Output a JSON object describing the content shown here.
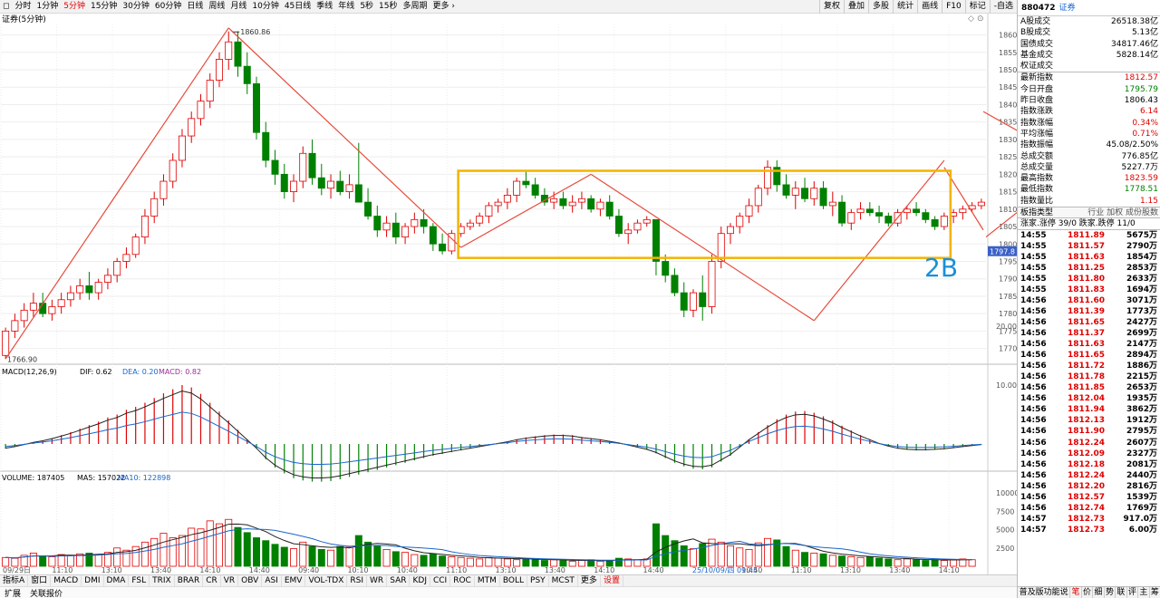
{
  "periods": [
    "分时",
    "1分钟",
    "5分钟",
    "15分钟",
    "30分钟",
    "60分钟",
    "日线",
    "周线",
    "月线",
    "10分钟",
    "45日线",
    "季线",
    "年线",
    "5秒",
    "15秒",
    "多周期",
    "更多 ›"
  ],
  "active_period": "5分钟",
  "toolbar_buttons": [
    "复权",
    "叠加",
    "多股",
    "统计",
    "画线",
    "F10",
    "标记",
    "-自选"
  ],
  "chart_title": "证券(5分钟)",
  "price_axis": [
    "1860",
    "1855",
    "1850",
    "1845",
    "1840",
    "1835",
    "1830",
    "1825",
    "1820",
    "1815",
    "1810",
    "1805",
    "1800",
    "1795",
    "1790",
    "1785",
    "1780",
    "1775",
    "1770"
  ],
  "price_annotations": {
    "high": "1860.86",
    "low": "1766.90",
    "current": "1797.8",
    "text_2b": "2B"
  },
  "macd": {
    "label": "MACD(12,26,9)",
    "dif": "DIF: 0.62",
    "dea": "DEA: 0.20",
    "macd": "MACD: 0.82",
    "ticks": [
      "20.00",
      "10.00"
    ]
  },
  "volume": {
    "label": "VOLUME: 187405",
    "ma5": "MA5: 157022",
    "ma10": "MA10: 122898",
    "ticks": [
      "10000",
      "7500",
      "5000",
      "2500"
    ]
  },
  "time_axis": [
    "09/29日",
    "11:10",
    "13:10",
    "13:40",
    "14:10",
    "14:40",
    "09:40",
    "10:10",
    "10:40",
    "11:10",
    "13:10",
    "13:40",
    "14:10",
    "14:40",
    "25/10/09/四 09:45",
    "10:40",
    "11:10",
    "13:10",
    "13:40",
    "14:10"
  ],
  "indicator_tabs": [
    "指标A",
    "窗口",
    "MACD",
    "DMI",
    "DMA",
    "FSL",
    "TRIX",
    "BRAR",
    "CR",
    "VR",
    "OBV",
    "ASI",
    "EMV",
    "VOL-TDX",
    "RSI",
    "WR",
    "SAR",
    "KDJ",
    "CCI",
    "ROC",
    "MTM",
    "BOLL",
    "PSY",
    "MCST",
    "更多",
    "设置"
  ],
  "bottom_tabs": [
    "扩展",
    "关联报价"
  ],
  "quote": {
    "code": "880472",
    "name": "证券",
    "stats_top": [
      [
        "A股成交",
        "26518.38亿"
      ],
      [
        "B股成交",
        "5.13亿"
      ],
      [
        "国债成交",
        "34817.46亿"
      ],
      [
        "基金成交",
        "5828.14亿"
      ],
      [
        "权证成交",
        ""
      ]
    ],
    "stats": [
      [
        "最新指数",
        "1812.57",
        "red"
      ],
      [
        "今日开盘",
        "1795.79",
        "grn"
      ],
      [
        "昨日收盘",
        "1806.43",
        ""
      ],
      [
        "指数涨跌",
        "6.14",
        "red"
      ],
      [
        "指数涨幅",
        "0.34%",
        "red"
      ],
      [
        "平均涨幅",
        "0.71%",
        "red"
      ],
      [
        "指数振幅",
        "45.08/2.50%",
        ""
      ],
      [
        "总成交额",
        "776.85亿",
        ""
      ],
      [
        "总成交量",
        "5227.7万",
        ""
      ],
      [
        "最高指数",
        "1823.59",
        "red"
      ],
      [
        "最低指数",
        "1778.51",
        "grn"
      ],
      [
        "指数量比",
        "1.15",
        "red"
      ]
    ],
    "board_type": {
      "label": "板指类型",
      "value": "行业 加权 成份股数"
    },
    "updown": "涨家.涨停  39/0 跌家.跌停  11/0",
    "ticks": [
      [
        "14:55",
        "1811.89",
        "5675万"
      ],
      [
        "14:55",
        "1811.57",
        "2790万"
      ],
      [
        "14:55",
        "1811.63",
        "1854万"
      ],
      [
        "14:55",
        "1811.25",
        "2853万"
      ],
      [
        "14:55",
        "1811.80",
        "2633万"
      ],
      [
        "14:55",
        "1811.83",
        "1694万"
      ],
      [
        "14:56",
        "1811.60",
        "3071万"
      ],
      [
        "14:56",
        "1811.39",
        "1773万"
      ],
      [
        "14:56",
        "1811.65",
        "2427万"
      ],
      [
        "14:56",
        "1811.37",
        "2699万"
      ],
      [
        "14:56",
        "1811.63",
        "2147万"
      ],
      [
        "14:56",
        "1811.65",
        "2894万"
      ],
      [
        "14:56",
        "1811.72",
        "1886万"
      ],
      [
        "14:56",
        "1811.78",
        "2215万"
      ],
      [
        "14:56",
        "1811.85",
        "2653万"
      ],
      [
        "14:56",
        "1812.04",
        "1935万"
      ],
      [
        "14:56",
        "1811.94",
        "3862万"
      ],
      [
        "14:56",
        "1812.13",
        "1912万"
      ],
      [
        "14:56",
        "1811.90",
        "2795万"
      ],
      [
        "14:56",
        "1812.24",
        "2607万"
      ],
      [
        "14:56",
        "1812.09",
        "2327万"
      ],
      [
        "14:56",
        "1812.18",
        "2081万"
      ],
      [
        "14:56",
        "1812.24",
        "2440万"
      ],
      [
        "14:56",
        "1812.20",
        "2816万"
      ],
      [
        "14:56",
        "1812.57",
        "1539万"
      ],
      [
        "14:56",
        "1812.74",
        "1769万"
      ],
      [
        "14:57",
        "1812.73",
        "917.0万"
      ],
      [
        "14:57",
        "1812.73",
        "6.00万"
      ]
    ],
    "footer": [
      "普及版功能说明",
      "笔",
      "价",
      "细",
      "势",
      "联",
      "评",
      "主",
      "筹"
    ]
  },
  "chart_data": {
    "type": "candlestick",
    "ylim": [
      1766,
      1863
    ],
    "ohlc": [
      [
        1768,
        1776,
        1767,
        1775
      ],
      [
        1775,
        1780,
        1773,
        1778
      ],
      [
        1778,
        1783,
        1776,
        1781
      ],
      [
        1781,
        1786,
        1779,
        1783
      ],
      [
        1783,
        1786,
        1779,
        1780
      ],
      [
        1780,
        1784,
        1778,
        1782
      ],
      [
        1782,
        1786,
        1780,
        1784
      ],
      [
        1784,
        1788,
        1782,
        1786
      ],
      [
        1786,
        1790,
        1784,
        1788
      ],
      [
        1788,
        1792,
        1784,
        1786
      ],
      [
        1786,
        1790,
        1784,
        1789
      ],
      [
        1789,
        1793,
        1787,
        1791
      ],
      [
        1791,
        1796,
        1789,
        1795
      ],
      [
        1795,
        1799,
        1793,
        1797
      ],
      [
        1797,
        1803,
        1796,
        1802
      ],
      [
        1802,
        1810,
        1800,
        1808
      ],
      [
        1808,
        1815,
        1806,
        1813
      ],
      [
        1813,
        1820,
        1811,
        1818
      ],
      [
        1818,
        1826,
        1816,
        1824
      ],
      [
        1824,
        1833,
        1822,
        1831
      ],
      [
        1831,
        1838,
        1829,
        1836
      ],
      [
        1836,
        1843,
        1834,
        1841
      ],
      [
        1841,
        1849,
        1839,
        1847
      ],
      [
        1847,
        1855,
        1845,
        1853
      ],
      [
        1853,
        1861,
        1850,
        1858
      ],
      [
        1858,
        1861,
        1848,
        1851
      ],
      [
        1851,
        1855,
        1843,
        1846
      ],
      [
        1846,
        1848,
        1830,
        1832
      ],
      [
        1832,
        1835,
        1822,
        1824
      ],
      [
        1824,
        1827,
        1817,
        1820
      ],
      [
        1820,
        1823,
        1813,
        1815
      ],
      [
        1815,
        1820,
        1812,
        1818
      ],
      [
        1818,
        1828,
        1816,
        1826
      ],
      [
        1826,
        1830,
        1817,
        1819
      ],
      [
        1819,
        1823,
        1814,
        1816
      ],
      [
        1816,
        1820,
        1813,
        1818
      ],
      [
        1818,
        1821,
        1814,
        1815
      ],
      [
        1815,
        1820,
        1813,
        1817
      ],
      [
        1817,
        1829,
        1813,
        1812
      ],
      [
        1812,
        1816,
        1807,
        1808
      ],
      [
        1808,
        1811,
        1802,
        1804
      ],
      [
        1804,
        1808,
        1802,
        1806
      ],
      [
        1806,
        1809,
        1800,
        1802
      ],
      [
        1802,
        1806,
        1800,
        1805
      ],
      [
        1805,
        1809,
        1803,
        1807
      ],
      [
        1807,
        1810,
        1803,
        1805
      ],
      [
        1805,
        1806,
        1798,
        1800
      ],
      [
        1800,
        1803,
        1797,
        1798
      ],
      [
        1798,
        1804,
        1797,
        1803
      ],
      [
        1803,
        1806,
        1802,
        1805
      ],
      [
        1805,
        1807,
        1804,
        1806
      ],
      [
        1806,
        1809,
        1805,
        1808
      ],
      [
        1808,
        1812,
        1806,
        1811
      ],
      [
        1811,
        1813,
        1809,
        1812
      ],
      [
        1812,
        1816,
        1810,
        1814
      ],
      [
        1814,
        1819,
        1812,
        1818
      ],
      [
        1818,
        1821,
        1816,
        1817
      ],
      [
        1817,
        1819,
        1813,
        1814
      ],
      [
        1814,
        1816,
        1811,
        1812
      ],
      [
        1812,
        1815,
        1810,
        1813
      ],
      [
        1813,
        1815,
        1810,
        1811
      ],
      [
        1811,
        1814,
        1809,
        1812
      ],
      [
        1812,
        1815,
        1810,
        1813
      ],
      [
        1813,
        1814,
        1809,
        1810
      ],
      [
        1810,
        1813,
        1808,
        1812
      ],
      [
        1812,
        1814,
        1807,
        1808
      ],
      [
        1808,
        1810,
        1802,
        1803
      ],
      [
        1803,
        1806,
        1800,
        1804
      ],
      [
        1804,
        1807,
        1803,
        1806
      ],
      [
        1806,
        1808,
        1805,
        1807
      ],
      [
        1807,
        1796,
        1791,
        1795
      ],
      [
        1795,
        1797,
        1789,
        1791
      ],
      [
        1791,
        1793,
        1785,
        1786
      ],
      [
        1786,
        1789,
        1779,
        1781
      ],
      [
        1781,
        1787,
        1779,
        1786
      ],
      [
        1786,
        1791,
        1778,
        1782
      ],
      [
        1782,
        1797,
        1780,
        1795
      ],
      [
        1795,
        1805,
        1793,
        1803
      ],
      [
        1803,
        1806,
        1800,
        1805
      ],
      [
        1805,
        1809,
        1803,
        1808
      ],
      [
        1808,
        1813,
        1806,
        1811
      ],
      [
        1811,
        1817,
        1809,
        1816
      ],
      [
        1816,
        1824,
        1814,
        1822
      ],
      [
        1822,
        1824,
        1815,
        1817
      ],
      [
        1817,
        1820,
        1813,
        1814
      ],
      [
        1814,
        1818,
        1810,
        1816
      ],
      [
        1816,
        1819,
        1812,
        1813
      ],
      [
        1813,
        1818,
        1811,
        1816
      ],
      [
        1816,
        1818,
        1810,
        1811
      ],
      [
        1811,
        1815,
        1808,
        1812
      ],
      [
        1812,
        1814,
        1805,
        1806
      ],
      [
        1806,
        1810,
        1804,
        1809
      ],
      [
        1809,
        1812,
        1807,
        1810
      ],
      [
        1810,
        1812,
        1808,
        1809
      ],
      [
        1809,
        1811,
        1806,
        1808
      ],
      [
        1808,
        1809,
        1805,
        1806
      ],
      [
        1806,
        1810,
        1805,
        1809
      ],
      [
        1809,
        1811,
        1807,
        1810
      ],
      [
        1810,
        1812,
        1808,
        1809
      ],
      [
        1809,
        1810,
        1806,
        1807
      ],
      [
        1807,
        1808,
        1804,
        1805
      ],
      [
        1805,
        1809,
        1804,
        1808
      ],
      [
        1808,
        1810,
        1806,
        1809
      ],
      [
        1809,
        1811,
        1807,
        1810
      ],
      [
        1810,
        1812,
        1809,
        1811
      ],
      [
        1811,
        1813,
        1810,
        1812
      ]
    ],
    "volume": [
      1200,
      1100,
      1500,
      1800,
      1400,
      1300,
      1600,
      1500,
      1700,
      1800,
      1600,
      1900,
      2500,
      2200,
      2700,
      3300,
      3800,
      4500,
      3900,
      4200,
      5200,
      5100,
      6200,
      5800,
      6400,
      5300,
      4600,
      3900,
      3500,
      3000,
      2600,
      2400,
      3300,
      2700,
      2300,
      2200,
      2700,
      2600,
      4200,
      3300,
      2800,
      2300,
      2000,
      1900,
      1600,
      1500,
      1700,
      1400,
      1300,
      1200,
      1100,
      1000,
      1200,
      1100,
      1000,
      900,
      1000,
      900,
      800,
      900,
      800,
      700,
      800,
      900,
      700,
      800,
      1100,
      1000,
      900,
      1000,
      5800,
      4200,
      3500,
      2800,
      2400,
      3100,
      3700,
      3300,
      2800,
      2500,
      2300,
      3200,
      3800,
      3600,
      2700,
      2200,
      1900,
      1800,
      1700,
      1500,
      1400,
      1300,
      1200,
      1300,
      1100,
      1000,
      900,
      1000,
      900,
      800,
      900,
      800,
      900,
      1000,
      900
    ],
    "macd_hist": [
      -0.8,
      -0.5,
      -0.1,
      0.3,
      0.6,
      1,
      1.5,
      2,
      2.6,
      3.2,
      3.8,
      4.5,
      5,
      5.8,
      6.3,
      7,
      7.8,
      8.6,
      9.3,
      10,
      9.6,
      8.5,
      7,
      5.5,
      4,
      2.4,
      0.8,
      -0.8,
      -2.6,
      -4,
      -5,
      -5.8,
      -6.2,
      -6.4,
      -6.4,
      -6.3,
      -6,
      -5.6,
      -5.2,
      -4.8,
      -4.4,
      -4,
      -3.6,
      -3.2,
      -2.8,
      -2.4,
      -2,
      -1.7,
      -1.4,
      -1.1,
      -0.8,
      -0.5,
      -0.2,
      0.1,
      0.4,
      0.8,
      1.1,
      1.3,
      1.5,
      1.6,
      1.6,
      1.5,
      1.2,
      1,
      0.8,
      0.5,
      0.2,
      -0.2,
      -0.6,
      -1,
      -1.6,
      -2.4,
      -3.2,
      -3.8,
      -4.2,
      -4.3,
      -4,
      -3,
      -2,
      -0.6,
      0.8,
      2,
      3.2,
      4.2,
      5,
      5.5,
      5.6,
      5.3,
      4.7,
      4,
      3.1,
      2.3,
      1.5,
      0.8,
      0.1,
      -0.4,
      -0.8,
      -1,
      -1.1,
      -1.1,
      -1,
      -0.9,
      -0.7,
      -0.5,
      -0.3,
      -0.1
    ]
  }
}
